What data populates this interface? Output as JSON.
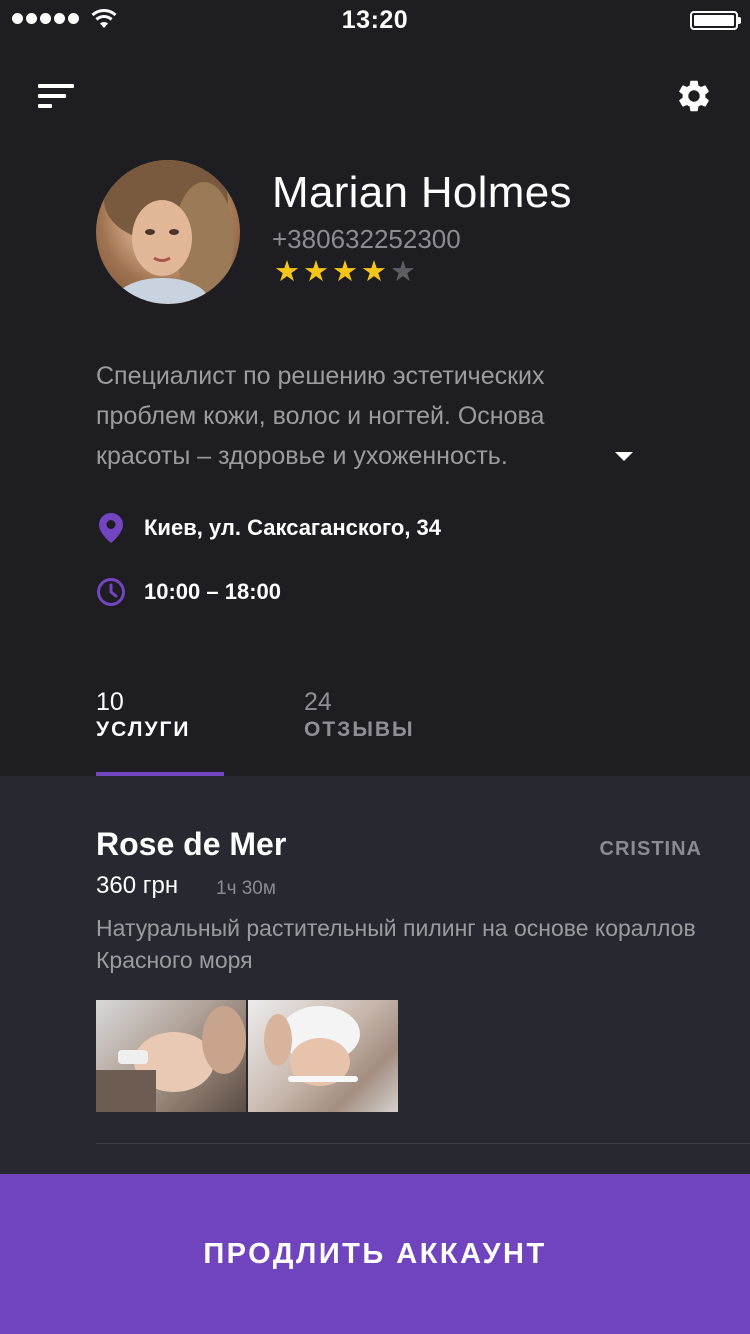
{
  "status_bar": {
    "time": "13:20"
  },
  "profile": {
    "name": "Marian Holmes",
    "phone": "+380632252300",
    "rating": 4,
    "rating_max": 5,
    "stars": [
      "★",
      "★",
      "★",
      "★",
      "★"
    ],
    "bio": "Специалист по решению эстетических проблем кожи, волос и ногтей. Основа красоты – здоровье и ухоженность.",
    "address": "Киев, ул. Саксаганского, 34",
    "hours": "10:00 – 18:00"
  },
  "tabs": [
    {
      "count": "10",
      "label": "УСЛУГИ",
      "active": true
    },
    {
      "count": "24",
      "label": "ОТЗЫВЫ",
      "active": false
    }
  ],
  "service": {
    "title": "Rose de Mer",
    "master": "CRISTINA",
    "price": "360 грн",
    "duration": "1ч 30м",
    "description": "Натуральный растительный пилинг на основе кораллов Красного моря"
  },
  "cta": {
    "label": "ПРОДЛИТЬ АККАУНТ"
  },
  "colors": {
    "background": "#1e1e22",
    "content_bg": "#282830",
    "accent": "#7044bf",
    "star_on": "#f5c518",
    "star_off": "#5d5d62"
  },
  "icons": [
    "menu-icon",
    "gear-icon",
    "location-pin-icon",
    "clock-icon",
    "chevron-down-icon",
    "wifi-icon",
    "battery-icon"
  ]
}
